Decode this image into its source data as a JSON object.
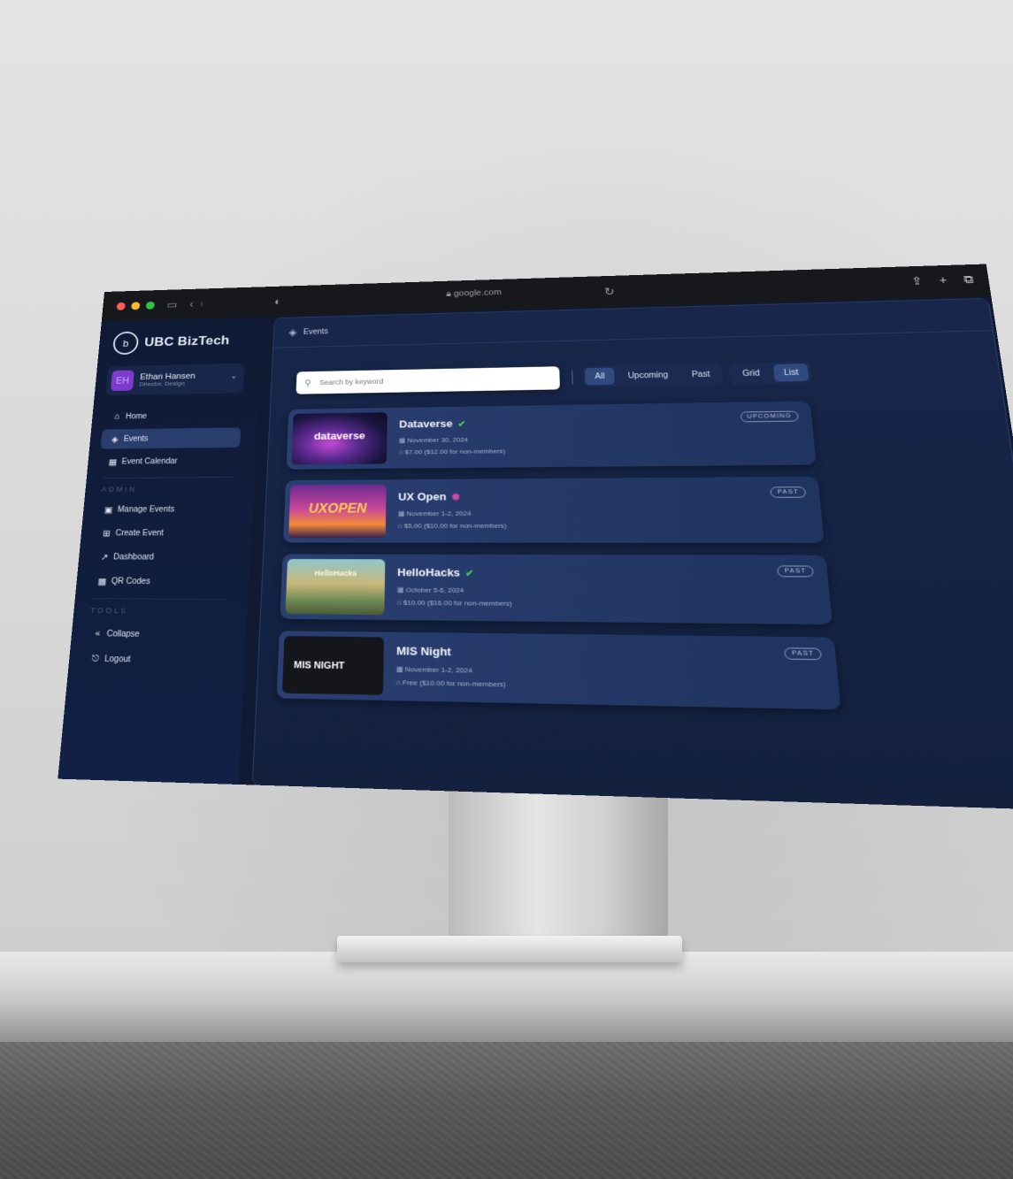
{
  "browser": {
    "url": "google.com",
    "traffic_light_colors": [
      "#ff5f57",
      "#febc2e",
      "#28c840"
    ]
  },
  "sidebar": {
    "brand": "UBC BizTech",
    "user": {
      "initials": "EH",
      "name": "Ethan Hansen",
      "role": "Director, Design"
    },
    "nav": [
      {
        "label": "Home",
        "icon": "home-icon"
      },
      {
        "label": "Events",
        "icon": "layers-icon",
        "active": true
      },
      {
        "label": "Event Calendar",
        "icon": "calendar-icon"
      }
    ],
    "admin_title": "ADMIN",
    "admin": [
      {
        "label": "Manage Events",
        "icon": "manage-icon"
      },
      {
        "label": "Create Event",
        "icon": "calendar-plus-icon"
      },
      {
        "label": "Dashboard",
        "icon": "chart-icon"
      },
      {
        "label": "QR Codes",
        "icon": "qr-icon"
      }
    ],
    "tools_title": "TOOLS",
    "tools": [
      {
        "label": "Collapse",
        "icon": "chevrons-left-icon"
      },
      {
        "label": "Logout",
        "icon": "logout-icon"
      }
    ]
  },
  "main": {
    "breadcrumb": "Events",
    "search_placeholder": "Search by keyword",
    "filters": [
      "All",
      "Upcoming",
      "Past"
    ],
    "active_filter": "All",
    "views": [
      "Grid",
      "List"
    ],
    "active_view": "List"
  },
  "events": [
    {
      "title": "Dataverse",
      "thumb_label": "dataverse",
      "status_icon": "check-circle-icon",
      "date": "November 30, 2024",
      "price": "$7.00 ($12.00 for non-members)",
      "badge": "UPCOMING"
    },
    {
      "title": "UX Open",
      "thumb_label": "UXOPEN",
      "status_icon": "pending-icon",
      "date": "November 1-2, 2024",
      "price": "$5.00 ($10.00 for non-members)",
      "badge": "PAST"
    },
    {
      "title": "HelloHacks",
      "thumb_label": "HelloHacks",
      "status_icon": "check-circle-icon",
      "date": "October 5-6, 2024",
      "price": "$10.00 ($16.00 for non-members)",
      "badge": "PAST"
    },
    {
      "title": "MIS Night",
      "thumb_label": "MIS NIGHT",
      "status_icon": "",
      "date": "November 1-2, 2024",
      "price": "Free ($10.00 for non-members)",
      "badge": "PAST"
    }
  ]
}
